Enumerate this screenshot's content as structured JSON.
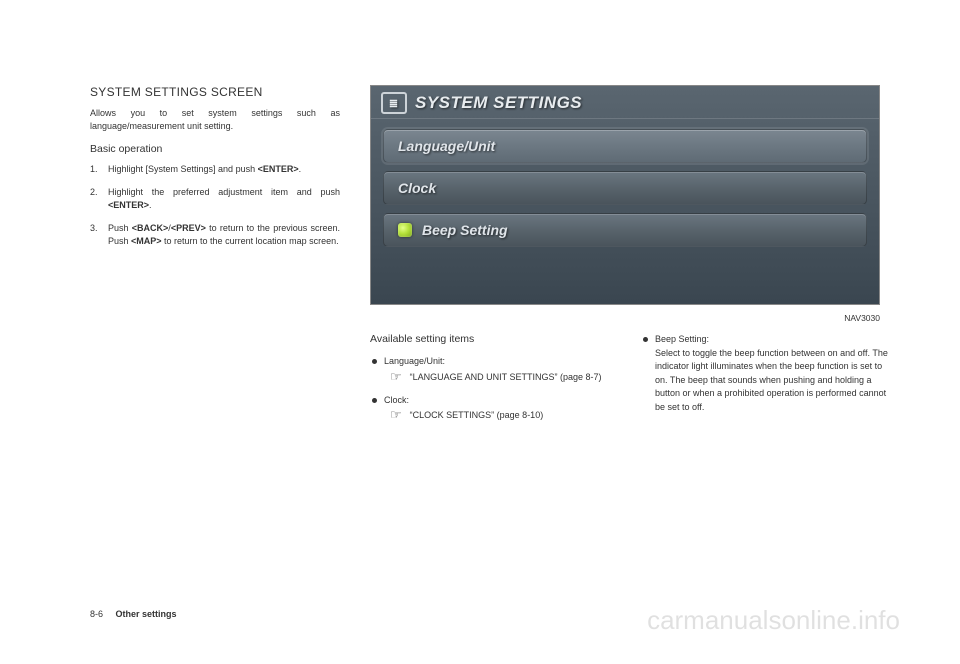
{
  "heading": "SYSTEM SETTINGS SCREEN",
  "intro": "Allows you to set system settings such as language/measurement unit setting.",
  "basic_op_heading": "Basic operation",
  "steps": {
    "s1_a": "Highlight [System Settings] and push ",
    "s1_b": "<ENTER>",
    "s1_c": ".",
    "s2_a": "Highlight the preferred adjustment item and push ",
    "s2_b": "<ENTER>",
    "s2_c": ".",
    "s3_a": "Push ",
    "s3_b": "<BACK>",
    "s3_c": "/",
    "s3_d": "<PREV>",
    "s3_e": " to return to the previous screen. Push ",
    "s3_f": "<MAP>",
    "s3_g": " to return to the current location map screen."
  },
  "screenshot": {
    "title": "SYSTEM SETTINGS",
    "items": {
      "lang": "Language/Unit",
      "clock": "Clock",
      "beep": "Beep Setting"
    }
  },
  "figure_id": "NAV3030",
  "available_heading": "Available setting items",
  "avail": {
    "lang_label": "Language/Unit:",
    "lang_ref": "“LANGUAGE AND UNIT SETTINGS” (page 8-7)",
    "clock_label": "Clock:",
    "clock_ref": "“CLOCK SETTINGS” (page 8-10)",
    "beep_label": "Beep Setting:",
    "beep_desc": "Select to toggle the beep function between on and off. The indicator light illuminates when the beep function is set to on. The beep that sounds when pushing and holding a button or when a prohibited operation is performed cannot be set to off."
  },
  "footer": {
    "page": "8-6",
    "section": "Other settings"
  },
  "watermark": "carmanualsonline.info",
  "ref_icon": "☞"
}
